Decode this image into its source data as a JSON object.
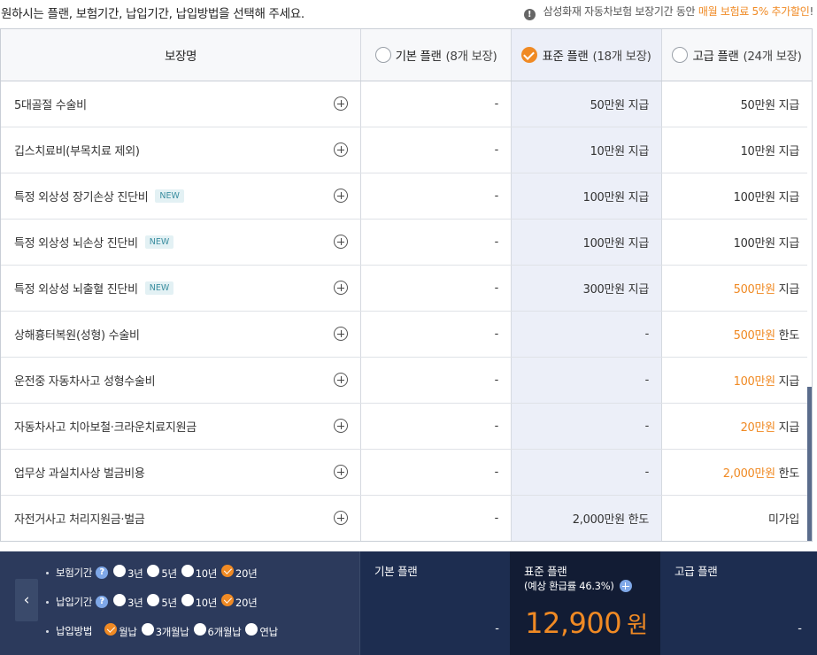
{
  "header": {
    "instruction": "원하시는 플랜, 보험기간, 납입기간, 납입방법을 선택해 주세요.",
    "notice_prefix": "삼성화재 자동차보험 보장기간 동안",
    "notice_highlight": "매월 보험료 5% 추가할인",
    "notice_suffix": "!"
  },
  "table": {
    "col_name": "보장명",
    "plans": [
      {
        "name": "기본 플랜",
        "count": "(8개 보장)",
        "selected": false
      },
      {
        "name": "표준 플랜",
        "count": "(18개 보장)",
        "selected": true
      },
      {
        "name": "고급 플랜",
        "count": "(24개 보장)",
        "selected": false
      }
    ],
    "new_badge": "NEW",
    "rows": [
      {
        "name": "5대골절 수술비",
        "new": false,
        "basic": "-",
        "std": "50만원 지급",
        "prem_amount": "50만원",
        "prem_suffix": " 지급",
        "prem_orange": false
      },
      {
        "name": "깁스치료비(부목치료 제외)",
        "new": false,
        "basic": "-",
        "std": "10만원 지급",
        "prem_amount": "10만원",
        "prem_suffix": " 지급",
        "prem_orange": false
      },
      {
        "name": "특정 외상성 장기손상 진단비",
        "new": true,
        "basic": "-",
        "std": "100만원 지급",
        "prem_amount": "100만원",
        "prem_suffix": " 지급",
        "prem_orange": false
      },
      {
        "name": "특정 외상성 뇌손상 진단비",
        "new": true,
        "basic": "-",
        "std": "100만원 지급",
        "prem_amount": "100만원",
        "prem_suffix": " 지급",
        "prem_orange": false
      },
      {
        "name": "특정 외상성 뇌출혈 진단비",
        "new": true,
        "basic": "-",
        "std": "300만원 지급",
        "prem_amount": "500만원",
        "prem_suffix": " 지급",
        "prem_orange": true
      },
      {
        "name": "상해흉터복원(성형) 수술비",
        "new": false,
        "basic": "-",
        "std": "-",
        "prem_amount": "500만원",
        "prem_suffix": " 한도",
        "prem_orange": true
      },
      {
        "name": "운전중 자동차사고 성형수술비",
        "new": false,
        "basic": "-",
        "std": "-",
        "prem_amount": "100만원",
        "prem_suffix": " 지급",
        "prem_orange": true
      },
      {
        "name": "자동차사고 치아보철·크라운치료지원금",
        "new": false,
        "basic": "-",
        "std": "-",
        "prem_amount": "20만원",
        "prem_suffix": " 지급",
        "prem_orange": true
      },
      {
        "name": "업무상 과실치사상 벌금비용",
        "new": false,
        "basic": "-",
        "std": "-",
        "prem_amount": "2,000만원",
        "prem_suffix": " 한도",
        "prem_orange": true
      },
      {
        "name": "자전거사고 처리지원금·벌금",
        "new": false,
        "basic": "-",
        "std": "2,000만원 한도",
        "prem_amount": "미가입",
        "prem_suffix": "",
        "prem_orange": false
      }
    ]
  },
  "options": {
    "insurance_period": {
      "label": "보험기간",
      "choices": [
        "3년",
        "5년",
        "10년",
        "20년"
      ],
      "selected": "20년"
    },
    "payment_period": {
      "label": "납입기간",
      "choices": [
        "3년",
        "5년",
        "10년",
        "20년"
      ],
      "selected": "20년"
    },
    "payment_method": {
      "label": "납입방법",
      "choices": [
        "월납",
        "3개월납",
        "6개월납",
        "연납"
      ],
      "selected": "월납"
    }
  },
  "summary": {
    "basic": {
      "name": "기본 플랜",
      "price": "-"
    },
    "std": {
      "name": "표준 플랜",
      "refund": "(예상 환급률 46.3%)",
      "price": "12,900",
      "unit": "원"
    },
    "prem": {
      "name": "고급 플랜",
      "price": "-"
    }
  },
  "colors": {
    "accent": "#f08a24",
    "navy": "#1d2d50",
    "std_band": "#eceff8"
  }
}
